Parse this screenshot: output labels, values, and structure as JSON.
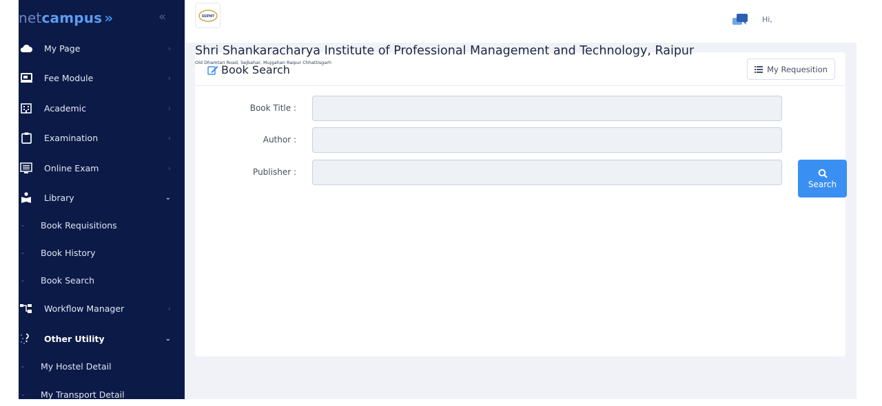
{
  "brand": {
    "prefix": "net",
    "name": "campus",
    "chevrons": "»",
    "collapse": "«"
  },
  "sidebar": {
    "items": [
      {
        "label": "My Page",
        "arrow": "›"
      },
      {
        "label": "Fee Module",
        "arrow": "›"
      },
      {
        "label": "Academic",
        "arrow": "›"
      },
      {
        "label": "Examination",
        "arrow": "›"
      },
      {
        "label": "Online Exam",
        "arrow": "›"
      },
      {
        "label": "Library",
        "arrow": "⌄"
      },
      {
        "label": "Workflow Manager",
        "arrow": "›"
      },
      {
        "label": "Other Utility",
        "arrow": "⌄"
      }
    ],
    "library_sub": [
      "Book Requisitions",
      "Book History",
      "Book Search"
    ],
    "utility_sub": [
      "My Hostel Detail",
      "My Transport Detail"
    ],
    "sub_dash": "-"
  },
  "header": {
    "greeting": "Hi,",
    "institute_logo_text": "SSIPMT"
  },
  "institute": {
    "name": "Shri Shankaracharya Institute of Professional Management and Technology, Raipur",
    "address": "Old Dhamtari Road, Sejbahar, Mujgahan Raipur Chhattisgarh"
  },
  "card": {
    "title": "Book Search",
    "requisition_button": "My Requesition"
  },
  "form": {
    "fields": [
      {
        "label": "Book Title :",
        "value": ""
      },
      {
        "label": "Author :",
        "value": ""
      },
      {
        "label": "Publisher :",
        "value": ""
      }
    ],
    "search_button": "Search"
  },
  "colors": {
    "sidebar": "#0b1a47",
    "accent": "#3a8ff2",
    "content_bg": "#f0f2f7"
  }
}
